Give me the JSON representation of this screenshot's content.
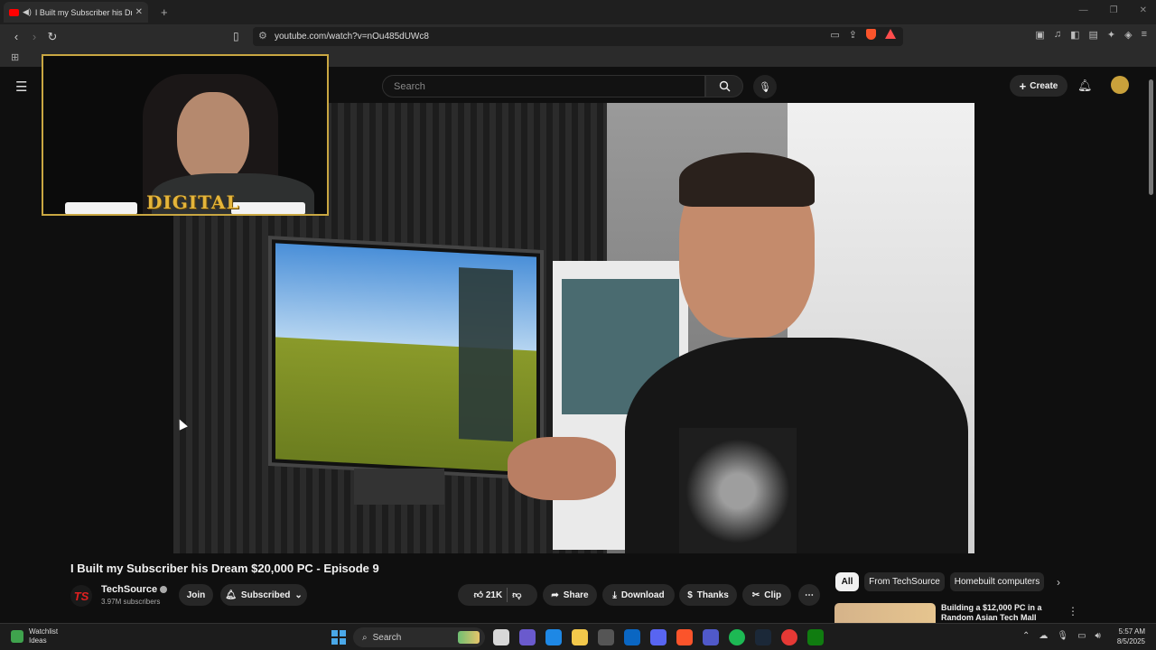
{
  "browser": {
    "tab_title": "I Built my Subscriber his Dream",
    "url": "youtube.com/watch?v=nOu485dUWc8"
  },
  "youtube": {
    "search_placeholder": "Search",
    "create_label": "Create"
  },
  "overlay": {
    "logo_text": "DIGITAL"
  },
  "video": {
    "title": "I Built my Subscriber his Dream $20,000 PC - Episode 9",
    "channel_name": "TechSource",
    "subscribers": "3.97M subscribers",
    "join_label": "Join",
    "subscribed_label": "Subscribed",
    "likes": "21K",
    "share_label": "Share",
    "download_label": "Download",
    "thanks_label": "Thanks",
    "clip_label": "Clip"
  },
  "chips": {
    "all": "All",
    "from_channel": "From TechSource",
    "topic": "Homebuilt computers"
  },
  "recommended": {
    "title": "Building a $12,000 PC in a Random Asian Tech Mall"
  },
  "taskbar": {
    "weather_line1": "Watchlist",
    "weather_line2": "Ideas",
    "search_label": "Search",
    "time": "5:57 AM",
    "date": "8/5/2025"
  },
  "colors": {
    "youtube_red": "#ff0000",
    "webcam_border": "#c9a742",
    "background": "#0f0f0f"
  }
}
